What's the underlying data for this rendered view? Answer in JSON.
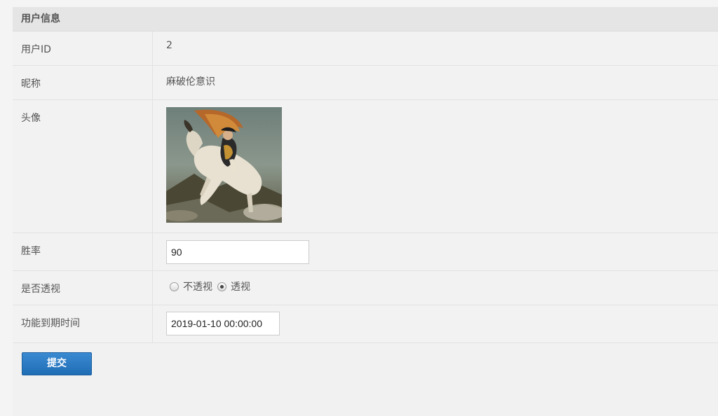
{
  "panel": {
    "title": "用户信息"
  },
  "fields": {
    "user_id": {
      "label": "用户ID",
      "value": "2"
    },
    "nickname": {
      "label": "昵称",
      "value": "麻破伦意识"
    },
    "avatar": {
      "label": "头像",
      "alt": "Napoleon crossing the Alps painting avatar"
    },
    "win_rate": {
      "label": "胜率",
      "value": "90"
    },
    "see_through": {
      "label": "是否透视",
      "options": [
        "不透视",
        "透视"
      ],
      "selected": "透视"
    },
    "expire_time": {
      "label": "功能到期时间",
      "value": "2019-01-10 00:00:00"
    }
  },
  "actions": {
    "submit_label": "提交"
  },
  "colors": {
    "button_blue": "#2a7cc7",
    "header_bg": "#e5e5e5",
    "page_bg": "#f1f1f1"
  }
}
